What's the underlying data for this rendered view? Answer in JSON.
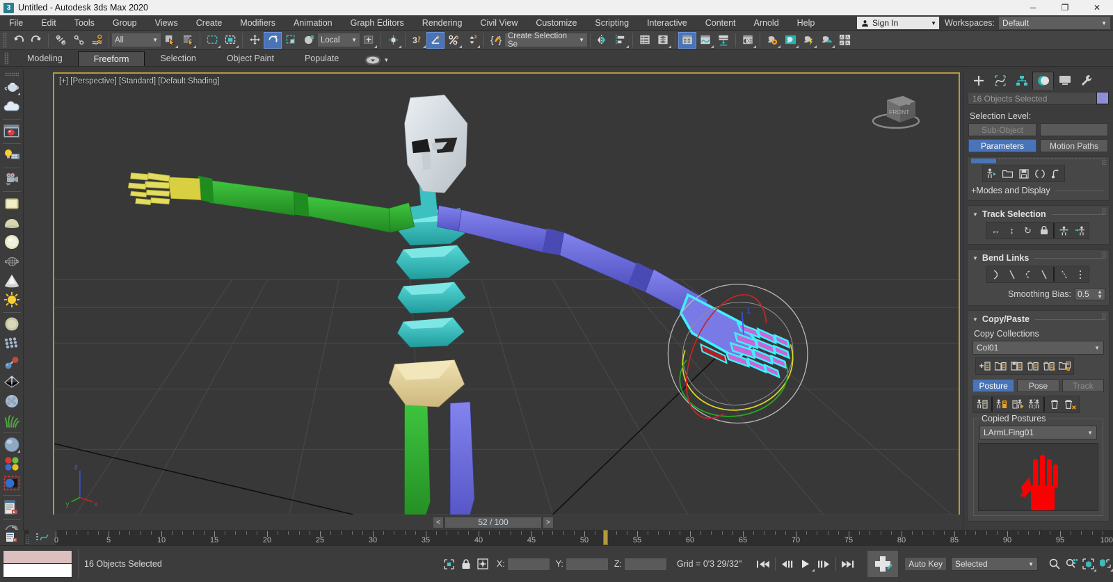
{
  "window": {
    "title": "Untitled - Autodesk 3ds Max 2020",
    "app_icon": "3",
    "minimize": "─",
    "maximize": "❐",
    "close": "✕"
  },
  "menubar": {
    "items": [
      "File",
      "Edit",
      "Tools",
      "Group",
      "Views",
      "Create",
      "Modifiers",
      "Animation",
      "Graph Editors",
      "Rendering",
      "Civil View",
      "Customize",
      "Scripting",
      "Interactive",
      "Content",
      "Arnold",
      "Help"
    ],
    "sign_in": "Sign In",
    "workspaces_label": "Workspaces:",
    "workspace_value": "Default"
  },
  "main_toolbar": {
    "selection_filter": "All",
    "reference_coord": "Local",
    "named_selection_set": "Create Selection Se",
    "items": [
      {
        "name": "undo-button",
        "icon": "undo",
        "active": false
      },
      {
        "name": "redo-button",
        "icon": "redo",
        "active": false
      },
      {
        "name": "select-and-link-button",
        "icon": "link",
        "active": false
      },
      {
        "name": "unlink-selection-button",
        "icon": "unlink",
        "active": false
      },
      {
        "name": "bind-to-space-warp-button",
        "icon": "spacewarp",
        "active": false
      },
      {
        "name": "select-object-button",
        "icon": "arrow-select",
        "active": false
      },
      {
        "name": "select-by-name-button",
        "icon": "select-by-name",
        "active": false
      },
      {
        "name": "rectangular-selection-region-button",
        "icon": "rect-region",
        "active": false
      },
      {
        "name": "window-crossing-button",
        "icon": "window-crossing",
        "active": false
      },
      {
        "name": "select-and-move-button",
        "icon": "move",
        "active": false
      },
      {
        "name": "select-and-rotate-button",
        "icon": "rotate",
        "active": true
      },
      {
        "name": "select-and-scale-button",
        "icon": "scale",
        "active": false
      },
      {
        "name": "select-and-place-button",
        "icon": "place",
        "active": false
      },
      {
        "name": "use-center-flyout-button",
        "icon": "use-center",
        "active": false
      },
      {
        "name": "select-and-manipulate-button",
        "icon": "manipulate",
        "active": false
      },
      {
        "name": "snaps-toggle-button",
        "icon": "snap3",
        "active": false
      },
      {
        "name": "angle-snap-toggle-button",
        "icon": "angle-snap",
        "active": true
      },
      {
        "name": "percent-snap-toggle-button",
        "icon": "percent-snap",
        "active": false
      },
      {
        "name": "spinner-snap-toggle-button",
        "icon": "spinner-snap",
        "active": false
      },
      {
        "name": "edit-named-selection-sets-button",
        "icon": "named-sets",
        "active": false
      },
      {
        "name": "mirror-button",
        "icon": "mirror",
        "active": false
      },
      {
        "name": "align-button",
        "icon": "align",
        "active": false
      },
      {
        "name": "layer-explorer-button",
        "icon": "layers-list",
        "active": false
      },
      {
        "name": "scene-explorer-button",
        "icon": "scene-explorer",
        "active": false
      },
      {
        "name": "curve-editor-button",
        "icon": "curve-editor",
        "active": true
      },
      {
        "name": "schematic-view-button",
        "icon": "schematic",
        "active": false
      },
      {
        "name": "project-folder-button",
        "icon": "project-folder",
        "active": false
      },
      {
        "name": "material-editor-button",
        "icon": "material-editor",
        "active": false
      },
      {
        "name": "render-setup-button",
        "icon": "render-setup",
        "active": false
      },
      {
        "name": "rendered-frame-window-button",
        "icon": "render-frame",
        "active": false
      },
      {
        "name": "render-production-button",
        "icon": "render-production",
        "active": false
      },
      {
        "name": "render-iterative-button",
        "icon": "render-iterative",
        "active": false
      },
      {
        "name": "open-ase-button",
        "icon": "ase-grid",
        "active": false
      }
    ]
  },
  "ribbon": {
    "tabs": [
      {
        "label": "Modeling",
        "active": false
      },
      {
        "label": "Freeform",
        "active": true
      },
      {
        "label": "Selection",
        "active": false
      },
      {
        "label": "Object Paint",
        "active": false
      },
      {
        "label": "Populate",
        "active": false
      }
    ]
  },
  "left_toolbar": {
    "items": [
      {
        "name": "teapot-standard-primitives-icon",
        "glyph": "teapot-blue"
      },
      {
        "name": "cloud-compound-objects-icon",
        "glyph": "cloud"
      },
      {
        "name": "render-preview-icon",
        "glyph": "render-window"
      },
      {
        "name": "lights-icon",
        "glyph": "lightbulb"
      },
      {
        "name": "camera-icon",
        "glyph": "camera"
      },
      {
        "name": "box-primitive-icon",
        "glyph": "box"
      },
      {
        "name": "dome-primitive-icon",
        "glyph": "dome"
      },
      {
        "name": "sphere-primitive-icon",
        "glyph": "sphere"
      },
      {
        "name": "teapot-wire-icon",
        "glyph": "teapot-wire"
      },
      {
        "name": "cone-primitive-icon",
        "glyph": "cone"
      },
      {
        "name": "sun-light-icon",
        "glyph": "sun"
      },
      {
        "name": "sphere-gizmo-icon",
        "glyph": "sphere-dim"
      },
      {
        "name": "particle-array-icon",
        "glyph": "particles"
      },
      {
        "name": "compound-object-icon",
        "glyph": "atoms"
      },
      {
        "name": "mesh-arrow-icon",
        "glyph": "mesh-arrow"
      },
      {
        "name": "noise-blob-icon",
        "glyph": "blob"
      },
      {
        "name": "grass-foliage-icon",
        "glyph": "grass"
      },
      {
        "name": "material-sphere-icon",
        "glyph": "mat-sphere"
      },
      {
        "name": "color-swatches-icon",
        "glyph": "swatches"
      },
      {
        "name": "object-color-icon",
        "glyph": "object-color"
      },
      {
        "name": "maxscript-listener-icon",
        "glyph": "script-listener"
      },
      {
        "name": "arc-rotate-icon",
        "glyph": "arc"
      }
    ]
  },
  "viewport": {
    "label": "[+] [Perspective] [Standard] [Default Shading]",
    "viewcube_front": "FRONT",
    "bg_color": "#383838",
    "border_color": "#b39a3e",
    "figure": {
      "head_color": "#d8dde2",
      "left_arm_color": "#31a531",
      "right_arm_color": "#6b6bdc",
      "spine_color": "#36b5b5",
      "pelvis_color": "#e0d09a",
      "left_leg_color": "#31a531",
      "right_leg_color": "#6b6bdc",
      "left_hand_color": "#d8d040",
      "selected_hand_outline": "#3ff0ff",
      "finger_color": "#c866d8"
    },
    "gizmo": {
      "x_axis_color": "#cc2222",
      "y_axis_color": "#22aa22",
      "z_axis_color": "#dddd22",
      "outer_ring_color": "#b8b8b8"
    },
    "axis_tripod": {
      "z": "z",
      "y": "y",
      "x": "x"
    }
  },
  "command_panel": {
    "tabs": [
      {
        "name": "create-tab",
        "icon": "plus",
        "active": false
      },
      {
        "name": "modify-tab",
        "icon": "modify",
        "active": false
      },
      {
        "name": "hierarchy-tab",
        "icon": "hierarchy",
        "active": false
      },
      {
        "name": "motion-tab",
        "icon": "motion",
        "active": true
      },
      {
        "name": "display-tab",
        "icon": "display",
        "active": false
      },
      {
        "name": "utilities-tab",
        "icon": "wrench",
        "active": false
      }
    ],
    "object_name": "16 Objects Selected",
    "object_color": "#8e8ed6",
    "selection_level_label": "Selection Level:",
    "sub_object_button": "Sub-Object",
    "sub_object_dropdown": "",
    "parameters_button": "Parameters",
    "motion_paths_button": "Motion Paths",
    "biped_icons": [
      {
        "name": "figure-mode-icon",
        "glyph": "figure-mode"
      },
      {
        "name": "load-file-icon",
        "glyph": "folder"
      },
      {
        "name": "save-file-icon",
        "glyph": "save"
      },
      {
        "name": "convert-icon",
        "glyph": "convert"
      },
      {
        "name": "motion-flow-icon",
        "glyph": "motion-flow"
      }
    ],
    "modes_and_display": "+Modes and Display",
    "rollouts": [
      {
        "title": "Track Selection",
        "icons": [
          {
            "name": "body-horizontal-icon",
            "glyph": "↔"
          },
          {
            "name": "body-vertical-icon",
            "glyph": "↕"
          },
          {
            "name": "body-rotation-icon",
            "glyph": "↻"
          },
          {
            "name": "lock-com-keying-icon",
            "glyph": "lock"
          },
          {
            "name": "symmetrical-tracks-icon",
            "glyph": "symmetry"
          },
          {
            "name": "opposite-tracks-icon",
            "glyph": "opposite"
          }
        ]
      },
      {
        "title": "Bend Links",
        "icons": [
          {
            "name": "bend-links-mode-icon",
            "glyph": "bend1"
          },
          {
            "name": "twist-links-mode-icon",
            "glyph": "bend2"
          },
          {
            "name": "twist-individual-icon",
            "glyph": "bend3"
          },
          {
            "name": "smooth-twist-mode-icon",
            "glyph": "bend4"
          },
          {
            "name": "zero-twist-icon",
            "glyph": "bend5"
          },
          {
            "name": "zero-all-icon",
            "glyph": "bend6"
          }
        ],
        "smoothing_bias_label": "Smoothing Bias:",
        "smoothing_bias_value": "0.5"
      },
      {
        "title": "Copy/Paste",
        "copy_collections_label": "Copy Collections",
        "collection_value": "Col01",
        "collection_icons": [
          {
            "name": "create-collection-icon",
            "glyph": "col-new"
          },
          {
            "name": "load-collection-icon",
            "glyph": "col-load"
          },
          {
            "name": "save-collection-icon",
            "glyph": "col-save"
          },
          {
            "name": "delete-collection-icon",
            "glyph": "col-del"
          },
          {
            "name": "delete-all-collections-icon",
            "glyph": "col-delall"
          },
          {
            "name": "collection-options-icon",
            "glyph": "col-opts"
          }
        ],
        "mode_buttons": [
          {
            "label": "Posture",
            "active": true
          },
          {
            "label": "Pose",
            "active": false
          },
          {
            "label": "Track",
            "active": false,
            "disabled": true
          }
        ],
        "paste_icons": [
          {
            "name": "copy-posture-icon",
            "glyph": "copy-p"
          },
          {
            "name": "paste-posture-icon",
            "glyph": "paste-p"
          },
          {
            "name": "paste-posture-opposite-icon",
            "glyph": "paste-opp"
          },
          {
            "name": "paste-posture-mirrored-icon",
            "glyph": "paste-mir"
          },
          {
            "name": "delete-posture-icon",
            "glyph": "trash"
          },
          {
            "name": "delete-all-postures-icon",
            "glyph": "trash-all"
          }
        ],
        "copied_postures_label": "Copied Postures",
        "copied_posture_value": "LArmLFing01",
        "preview_color": "#ff0000"
      }
    ]
  },
  "time_slider": {
    "prev_label": "<",
    "next_label": ">",
    "frame_text": "52 / 100"
  },
  "track_bar": {
    "current_frame": 52,
    "range_start": 0,
    "range_end": 100,
    "tick_labels": [
      "0",
      "5",
      "10",
      "15",
      "20",
      "25",
      "30",
      "35",
      "40",
      "45",
      "50",
      "55",
      "60",
      "65",
      "70",
      "75",
      "80",
      "85",
      "90",
      "95",
      "100"
    ],
    "curve_editor_icon": "curve-editor-icon"
  },
  "status_bar": {
    "status_text": "16 Objects Selected",
    "selection_lock_icon": "lock-icon",
    "isolate_icon": "isolate-selection-icon",
    "x_label": "X:",
    "y_label": "Y:",
    "z_label": "Z:",
    "x_value": "",
    "y_value": "",
    "z_value": "",
    "grid_text": "Grid = 0'3 29/32\"",
    "playback": [
      {
        "name": "goto-start-button",
        "glyph": "❘◀◀"
      },
      {
        "name": "previous-frame-button",
        "glyph": "◀❘❘"
      },
      {
        "name": "play-animation-button",
        "glyph": "▶"
      },
      {
        "name": "next-frame-button",
        "glyph": "❘❘▶"
      },
      {
        "name": "goto-end-button",
        "glyph": "▶▶❘"
      }
    ],
    "set-key-button": "+",
    "auto_key_label": "Auto Key",
    "key_filters_value": "Selected",
    "view_tools": [
      {
        "name": "zoom-icon",
        "glyph": "zoom"
      },
      {
        "name": "zoom-all-icon",
        "glyph": "zoom-all"
      },
      {
        "name": "zoom-extents-icon",
        "glyph": "zoom-extents"
      },
      {
        "name": "zoom-region-icon",
        "glyph": "zoom-region"
      }
    ]
  }
}
